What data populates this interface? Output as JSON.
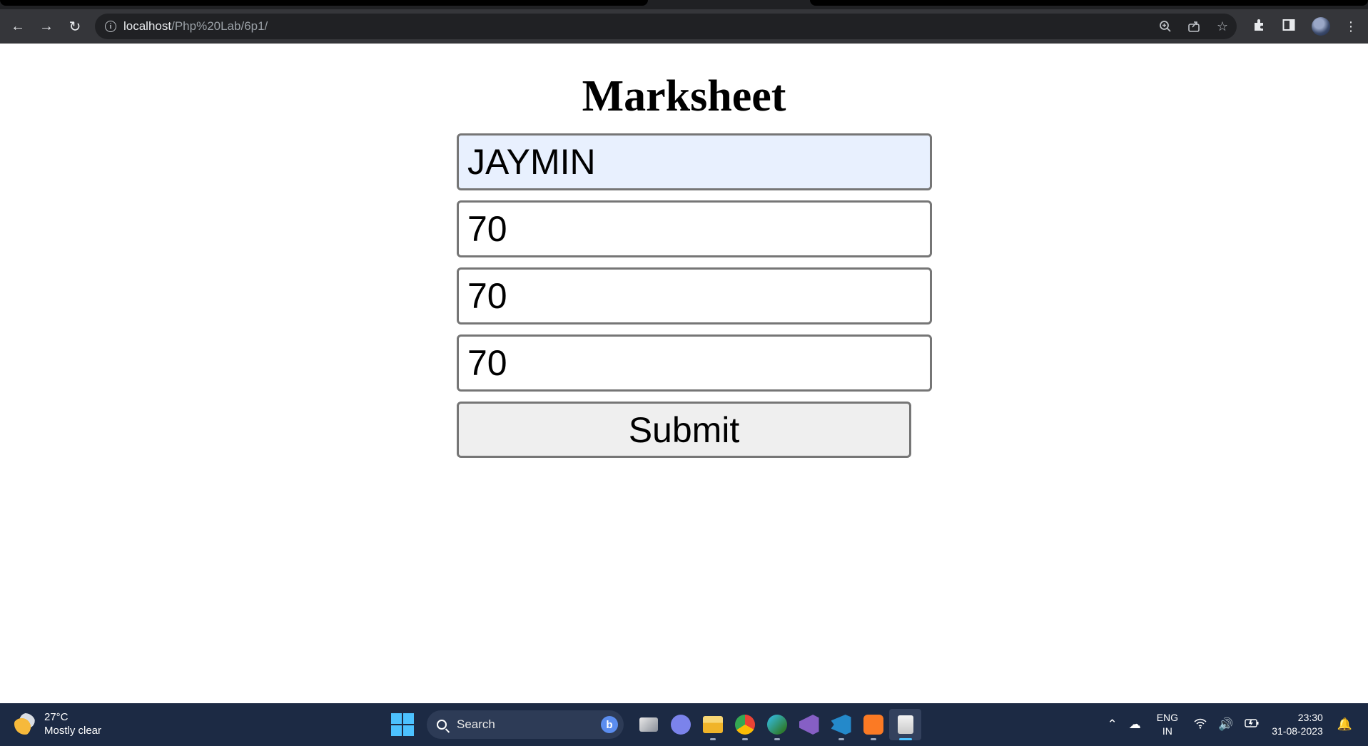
{
  "browser": {
    "url_host": "localhost",
    "url_path": "/Php%20Lab/6p1/",
    "icons": [
      "back-arrow-icon",
      "forward-arrow-icon",
      "reload-icon",
      "site-info-icon",
      "zoom-icon",
      "share-icon",
      "bookmark-star-icon",
      "extensions-icon",
      "side-panel-icon",
      "profile-avatar",
      "more-menu-icon"
    ]
  },
  "page": {
    "title": "Marksheet",
    "fields": [
      {
        "value": "JAYMIN",
        "autofilled": true
      },
      {
        "value": "70"
      },
      {
        "value": "70"
      },
      {
        "value": "70"
      }
    ],
    "submit_label": "Submit"
  },
  "taskbar": {
    "weather": {
      "temperature": "27°C",
      "condition": "Mostly clear"
    },
    "search_label": "Search",
    "language": {
      "line1": "ENG",
      "line2": "IN"
    },
    "clock": {
      "time": "23:30",
      "date": "31-08-2023"
    },
    "colors": {
      "accent": "#4cc2ff",
      "background": "#1c2a44"
    }
  }
}
